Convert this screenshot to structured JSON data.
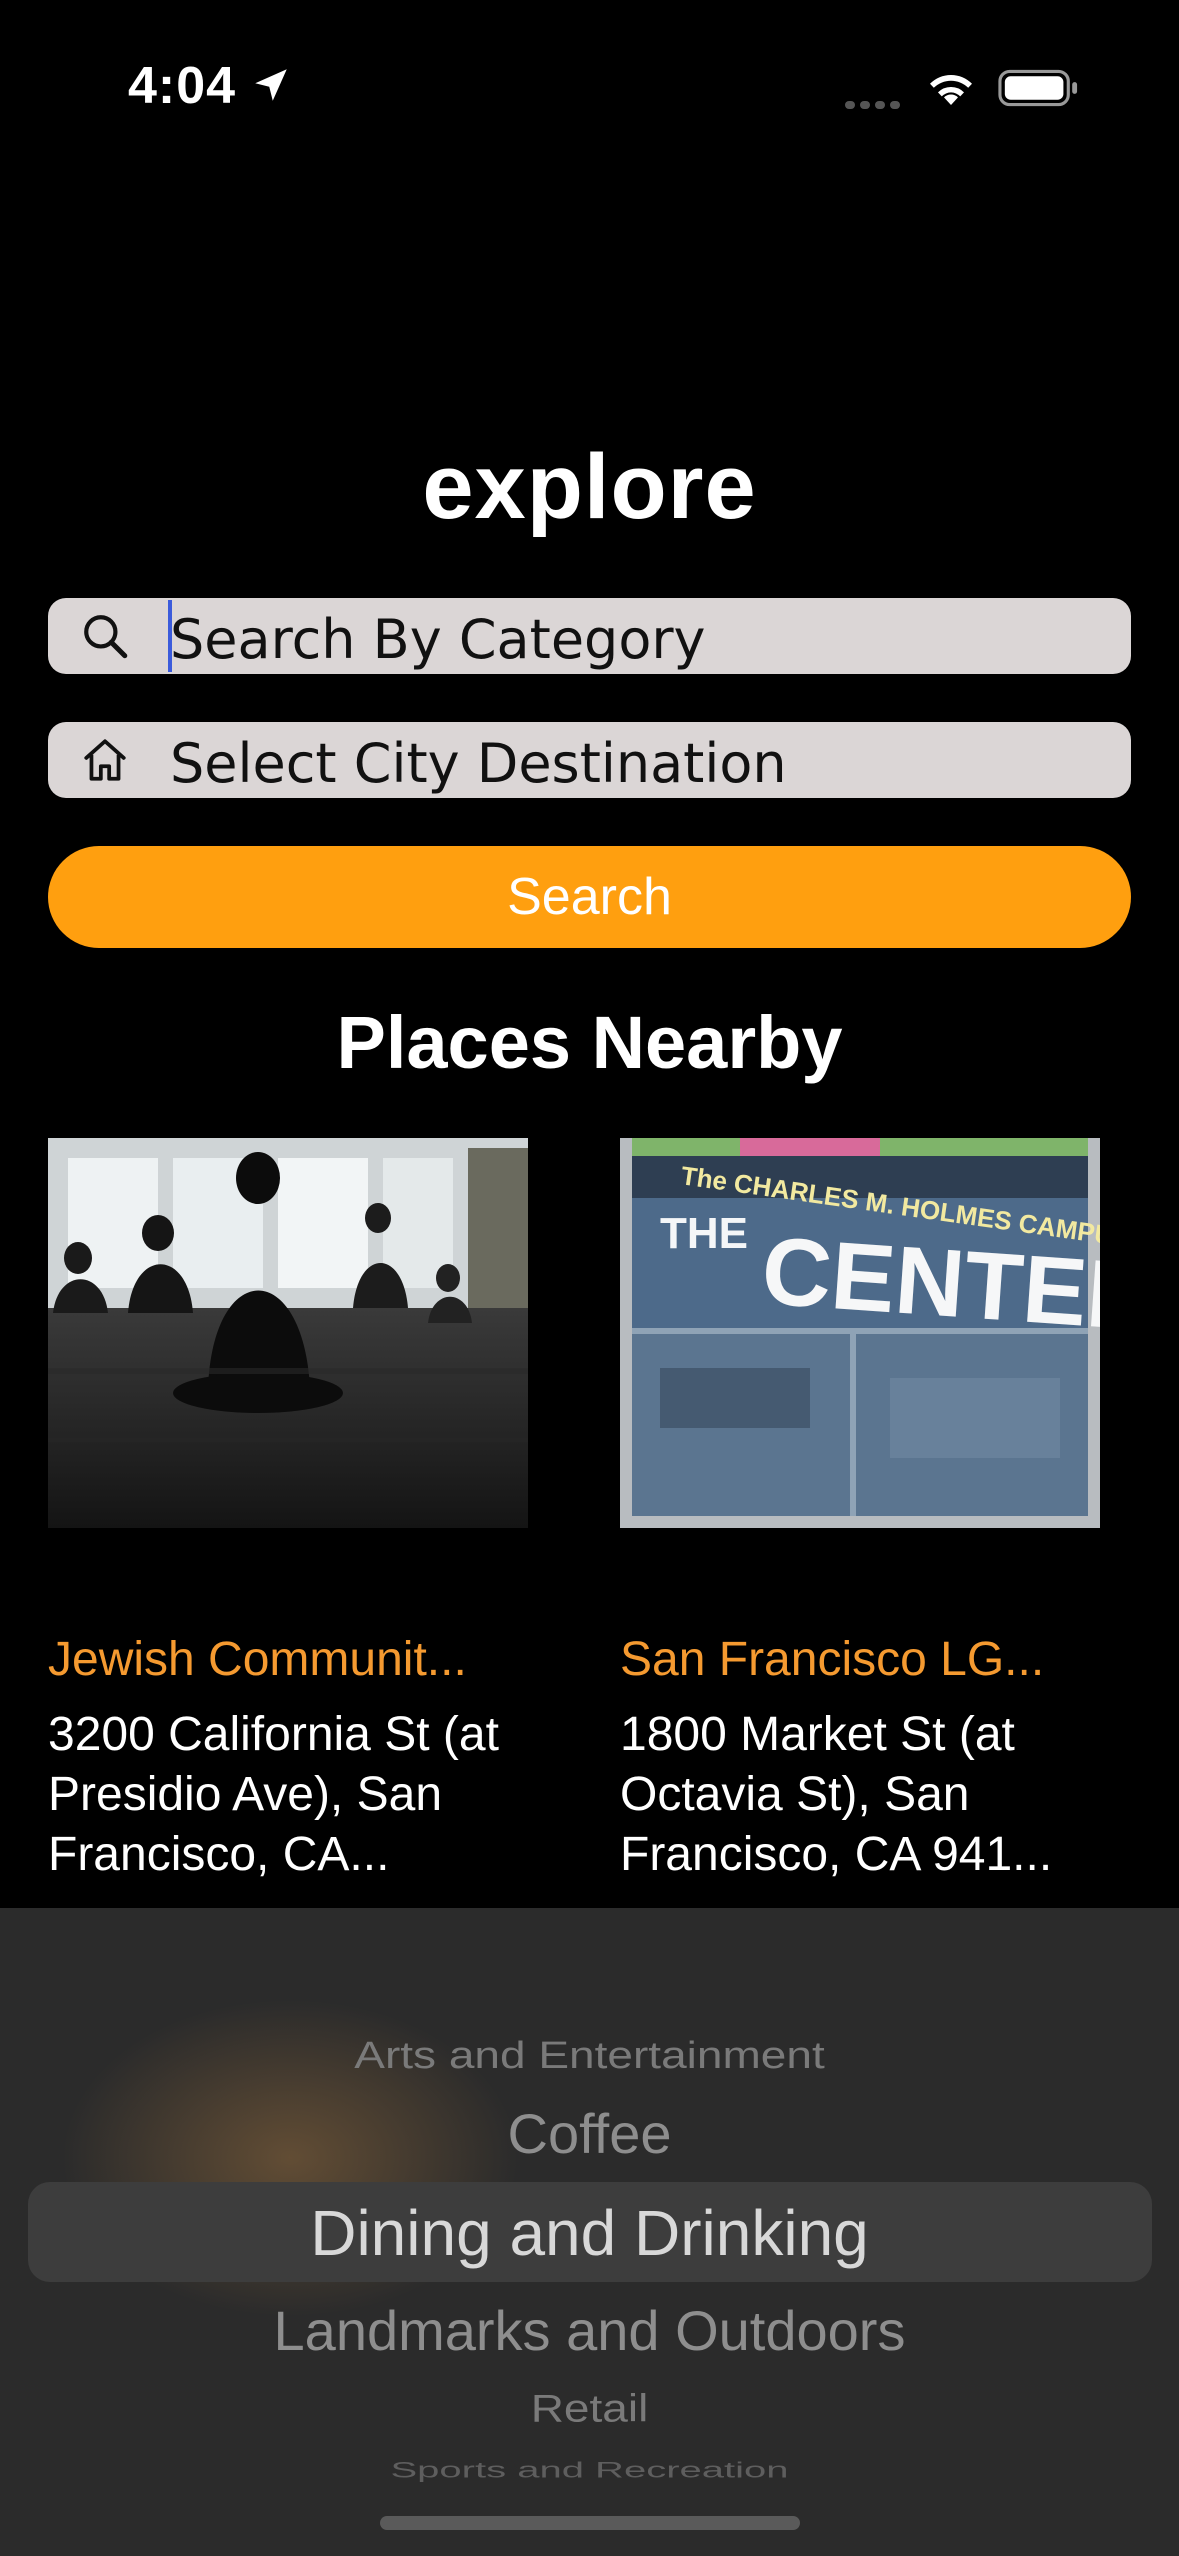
{
  "status_bar": {
    "time": "4:04"
  },
  "header": {
    "title": "explore"
  },
  "search": {
    "category_placeholder": "Search By Category",
    "city_placeholder": "Select City Destination",
    "button_label": "Search"
  },
  "nearby": {
    "title": "Places Nearby",
    "places": [
      {
        "name": "Jewish Communit...",
        "address": "3200 California St (at Presidio Ave), San Francisco, CA..."
      },
      {
        "name": "San Francisco LG...",
        "address": "1800 Market St (at Octavia St), San Francisco, CA 941..."
      }
    ]
  },
  "photo2_sign": {
    "line1": "The CHARLES M. HOLMES CAMPUS",
    "line2": "THE",
    "line3": "CENTER"
  },
  "picker": {
    "options": [
      "Arts and Entertainment",
      "Coffee",
      "Dining and Drinking",
      "Landmarks and Outdoors",
      "Retail",
      "Sports and Recreation"
    ],
    "selected": "Dining and Drinking"
  },
  "colors": {
    "accent": "#ff9f0f",
    "place_name": "#f59a30",
    "field_bg": "#dbd6d6"
  }
}
